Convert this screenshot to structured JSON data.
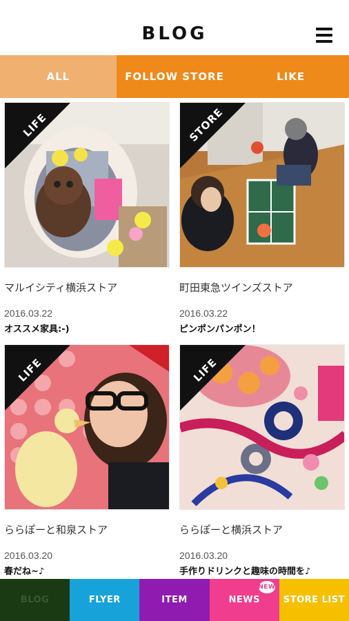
{
  "header": {
    "title": "BLOG"
  },
  "tabs": [
    {
      "label": "ALL"
    },
    {
      "label": "FOLLOW STORE"
    },
    {
      "label": "LIKE"
    }
  ],
  "posts": [
    {
      "category": "LIFE",
      "store": "マルイシティ横浜ストア",
      "date": "2016.03.22",
      "title": "オススメ家具:-)"
    },
    {
      "category": "STORE",
      "store": "町田東急ツインズストア",
      "date": "2016.03.22",
      "title": "ピンポンパンポン！"
    },
    {
      "category": "LIFE",
      "store": "ららぽーと和泉ストア",
      "date": "2016.03.20",
      "title": "春だね~♪"
    },
    {
      "category": "LIFE",
      "store": "ららぽーと横浜ストア",
      "date": "2016.03.20",
      "title": "手作りドリンクと趣味の時間を♪"
    }
  ],
  "bottom_nav": [
    {
      "label": "BLOG"
    },
    {
      "label": "FLYER"
    },
    {
      "label": "ITEM"
    },
    {
      "label": "NEWS",
      "badge": "NEW"
    },
    {
      "label": "STORE LIST"
    }
  ],
  "colors": {
    "tab_active": "#f0b070",
    "tab": "#ee8a1a",
    "nav_blog": "#1a3a14",
    "nav_flyer": "#17a3d9",
    "nav_item": "#8f1bb0",
    "nav_news": "#f03d8e",
    "nav_storelist": "#f6c000"
  },
  "icons": {
    "menu": "hamburger-menu-icon"
  }
}
